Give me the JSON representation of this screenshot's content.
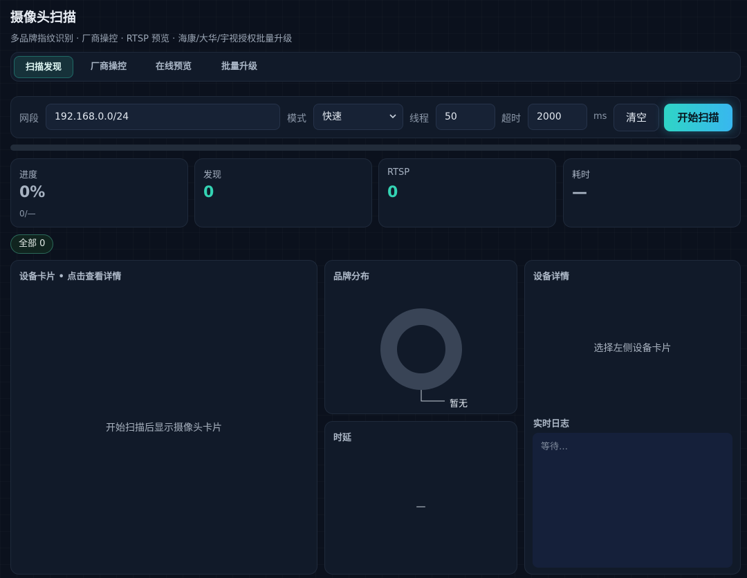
{
  "header": {
    "title": "摄像头扫描",
    "subtitle": "多品牌指纹识别 · 厂商操控 · RTSP 预览 · 海康/大华/宇视授权批量升级"
  },
  "tabs": [
    {
      "label": "扫描发现",
      "active": true
    },
    {
      "label": "厂商操控",
      "active": false
    },
    {
      "label": "在线预览",
      "active": false
    },
    {
      "label": "批量升级",
      "active": false
    }
  ],
  "toolbar": {
    "subnet_label": "网段",
    "subnet_value": "192.168.0.0/24",
    "mode_label": "模式",
    "mode_value": "快速",
    "threads_label": "线程",
    "threads_value": "50",
    "timeout_label": "超时",
    "timeout_value": "2000",
    "timeout_unit": "ms",
    "clear_label": "清空",
    "start_label": "开始扫描"
  },
  "progress": {
    "fraction": 0
  },
  "stats": {
    "progress": {
      "label": "进度",
      "value": "0%",
      "sub": "0/—"
    },
    "found": {
      "label": "发现",
      "value": "0"
    },
    "rtsp": {
      "label": "RTSP",
      "value": "0"
    },
    "elapsed": {
      "label": "耗时",
      "value": "—"
    }
  },
  "filter": {
    "all_label": "全部 0"
  },
  "devices_panel": {
    "title": "设备卡片 • 点击查看详情",
    "empty": "开始扫描后显示摄像头卡片"
  },
  "brand_panel": {
    "title": "品牌分布",
    "empty_label": "暂无"
  },
  "latency_panel": {
    "title": "时延",
    "empty": "—"
  },
  "detail_panel": {
    "title": "设备详情",
    "empty": "选择左侧设备卡片"
  },
  "log_panel": {
    "title": "实时日志",
    "placeholder": "等待…"
  },
  "colors": {
    "accent": "#2fd5c6",
    "accent2": "#38b7ef",
    "background": "#0b111d",
    "panel": "#111a29"
  },
  "icons": {
    "select_chevron": "chevron-down-icon"
  }
}
